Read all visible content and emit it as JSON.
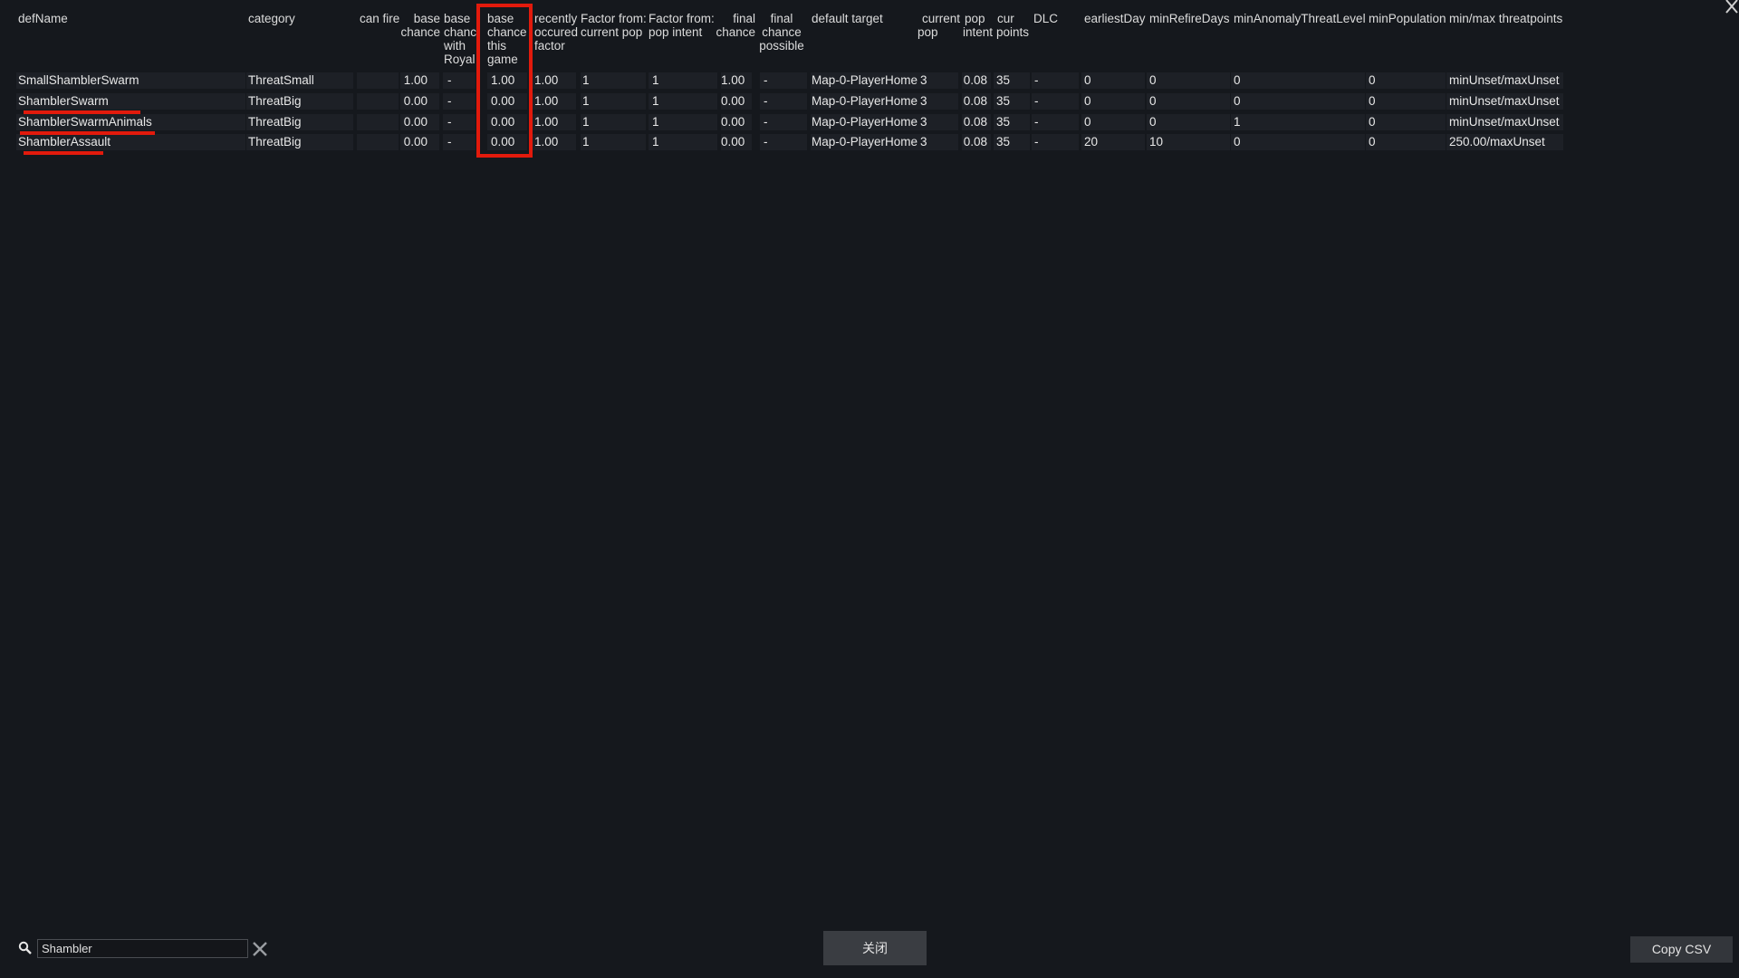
{
  "headers": {
    "defName": "defName",
    "category": "category",
    "can_fire": "can fire",
    "base_chance": [
      "base",
      "chance"
    ],
    "base_chance_royal": [
      "base",
      "chanc",
      "with",
      "Royal"
    ],
    "base_chance_game": [
      "base",
      "chance",
      "this",
      "game"
    ],
    "recently": [
      "recently",
      "occured",
      "factor"
    ],
    "factor_current_pop": [
      "Factor from:",
      "current pop"
    ],
    "factor_pop_intent": [
      "Factor from:",
      "pop intent"
    ],
    "final_chance": [
      "final",
      "chance"
    ],
    "final_possible": [
      "final",
      "chance",
      "possible"
    ],
    "default_target": "default target",
    "current_pop": [
      "current",
      "pop"
    ],
    "pop_intent": [
      "pop",
      "intent"
    ],
    "cur_points": [
      "cur",
      "points"
    ],
    "dlc": "DLC",
    "earliest_day": "earliestDay",
    "min_refire": "minRefireDays",
    "min_anomaly": "minAnomalyThreatLevel",
    "min_population": "minPopulation",
    "threatpoints": "min/max threatpoints"
  },
  "rows": [
    {
      "defName": "SmallShamblerSwarm",
      "category": "ThreatSmall",
      "can_fire": "",
      "base_chance": "1.00",
      "base_chance_royal": "-",
      "base_chance_game": "1.00",
      "recently": "1.00",
      "factor_current_pop": "1",
      "factor_pop_intent": "1",
      "final_chance": "1.00",
      "final_possible": "-",
      "default_target": "Map-0-PlayerHome",
      "current_pop": "3",
      "pop_intent": "0.08",
      "cur_points": "35",
      "dlc": "-",
      "earliest_day": "0",
      "min_refire": "0",
      "min_anomaly": "0",
      "min_population": "0",
      "threatpoints": "minUnset/maxUnset"
    },
    {
      "defName": "ShamblerSwarm",
      "category": "ThreatBig",
      "can_fire": "",
      "base_chance": "0.00",
      "base_chance_royal": "-",
      "base_chance_game": "0.00",
      "recently": "1.00",
      "factor_current_pop": "1",
      "factor_pop_intent": "1",
      "final_chance": "0.00",
      "final_possible": "-",
      "default_target": "Map-0-PlayerHome",
      "current_pop": "3",
      "pop_intent": "0.08",
      "cur_points": "35",
      "dlc": "-",
      "earliest_day": "0",
      "min_refire": "0",
      "min_anomaly": "0",
      "min_population": "0",
      "threatpoints": "minUnset/maxUnset"
    },
    {
      "defName": "ShamblerSwarmAnimals",
      "category": "ThreatBig",
      "can_fire": "",
      "base_chance": "0.00",
      "base_chance_royal": "-",
      "base_chance_game": "0.00",
      "recently": "1.00",
      "factor_current_pop": "1",
      "factor_pop_intent": "1",
      "final_chance": "0.00",
      "final_possible": "-",
      "default_target": "Map-0-PlayerHome",
      "current_pop": "3",
      "pop_intent": "0.08",
      "cur_points": "35",
      "dlc": "-",
      "earliest_day": "0",
      "min_refire": "0",
      "min_anomaly": "1",
      "min_population": "0",
      "threatpoints": "minUnset/maxUnset"
    },
    {
      "defName": "ShamblerAssault",
      "category": "ThreatBig",
      "can_fire": "",
      "base_chance": "0.00",
      "base_chance_royal": "-",
      "base_chance_game": "0.00",
      "recently": "1.00",
      "factor_current_pop": "1",
      "factor_pop_intent": "1",
      "final_chance": "0.00",
      "final_possible": "-",
      "default_target": "Map-0-PlayerHome",
      "current_pop": "3",
      "pop_intent": "0.08",
      "cur_points": "35",
      "dlc": "-",
      "earliest_day": "20",
      "min_refire": "10",
      "min_anomaly": "0",
      "min_population": "0",
      "threatpoints": "250.00/maxUnset"
    }
  ],
  "search": {
    "value": "Shambler",
    "icon": "search-icon"
  },
  "buttons": {
    "close_label": "关闭",
    "copy_csv_label": "Copy CSV"
  },
  "colors": {
    "highlight": "#e21a0c",
    "background": "#15181d"
  }
}
